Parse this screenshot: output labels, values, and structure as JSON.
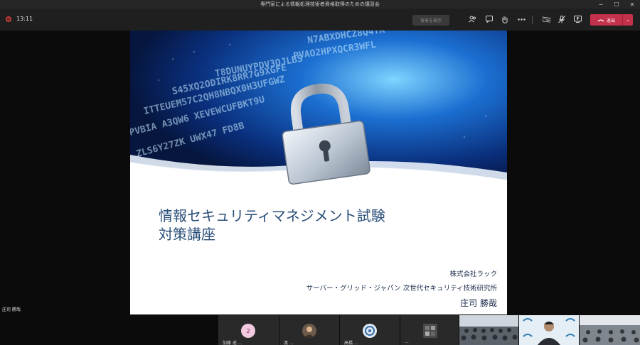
{
  "window": {
    "title": "専門家による情報処理技術者資格取得のための講習会",
    "controls": {
      "minimize": "─",
      "maximize": "☐",
      "close": "✕"
    }
  },
  "toolbar": {
    "timer": "13:11",
    "show_text_button": "背景を表示",
    "leave_label": "退出",
    "icons": [
      "participants-icon",
      "chat-icon",
      "raise-hand-icon",
      "more-icon",
      "camera-off-icon",
      "mic-off-icon",
      "share-icon"
    ],
    "accent_color": "#c4314b"
  },
  "slide": {
    "title_line1": "情報セキュリティマネジメント試験",
    "title_line2": "対策講座",
    "company": "株式会社ラック",
    "department": "サーバー・グリッド・ジャパン 次世代セキュリティ技術研究所",
    "presenter": "庄司 勝哉",
    "title_color": "#2a4f79"
  },
  "stage": {
    "speaker_name": "庄司 勝哉"
  },
  "participants": [
    {
      "avatar": "2",
      "name": "加藤 遥 ..."
    },
    {
      "avatar": "",
      "name": "渡 ..."
    },
    {
      "avatar": "",
      "name": "高橋 ..."
    },
    {
      "avatar": "",
      "name": "..."
    }
  ],
  "video_tiles": [
    {
      "name": ""
    },
    {
      "name": "庄司 勝哉"
    },
    {
      "name": ""
    }
  ]
}
